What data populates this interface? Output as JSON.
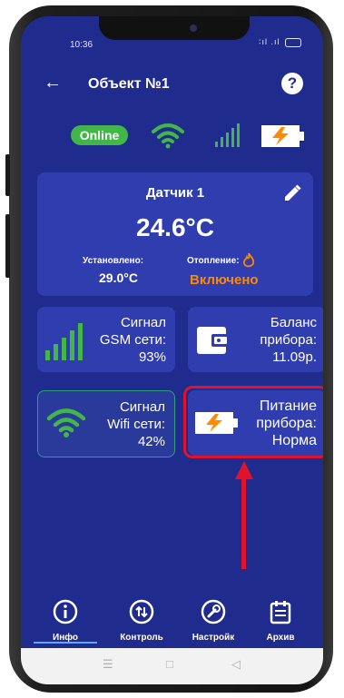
{
  "status_bar": {
    "time": "10:36",
    "signal_text": "∶ıl .ıl"
  },
  "app_bar": {
    "back_glyph": "←",
    "title": "Объект №1",
    "help_glyph": "?"
  },
  "indicators": {
    "online_label": "Online",
    "wifi_icon": "wifi-icon",
    "gsm_icon": "signal-bars-icon",
    "battery_icon": "battery-charging-icon"
  },
  "sensor": {
    "name": "Датчик 1",
    "temperature": "24.6°C",
    "set_label": "Установлено:",
    "set_value": "29.0°C",
    "heating_label": "Отопление:",
    "heating_value": "Включено"
  },
  "tiles": {
    "gsm": {
      "lines": [
        "Сигнал",
        "GSM сети:",
        "93%"
      ]
    },
    "balance": {
      "lines": [
        "Баланс",
        "прибора:",
        "11.09р."
      ]
    },
    "wifi": {
      "lines": [
        "Сигнал",
        "Wifi сети:",
        "42%"
      ]
    },
    "power": {
      "lines": [
        "Питание",
        "прибора:",
        "Норма"
      ]
    }
  },
  "nav": [
    {
      "label": "Инфо",
      "icon": "info-icon"
    },
    {
      "label": "Контроль",
      "icon": "arrows-icon"
    },
    {
      "label": "Настройк",
      "icon": "wrench-icon"
    },
    {
      "label": "Архив",
      "icon": "calendar-icon"
    }
  ],
  "colors": {
    "background": "#1f2c8e",
    "card": "#2f3dae",
    "accent_green": "#43b649",
    "accent_orange": "#ff8a00",
    "highlight_red": "#e0132a"
  }
}
